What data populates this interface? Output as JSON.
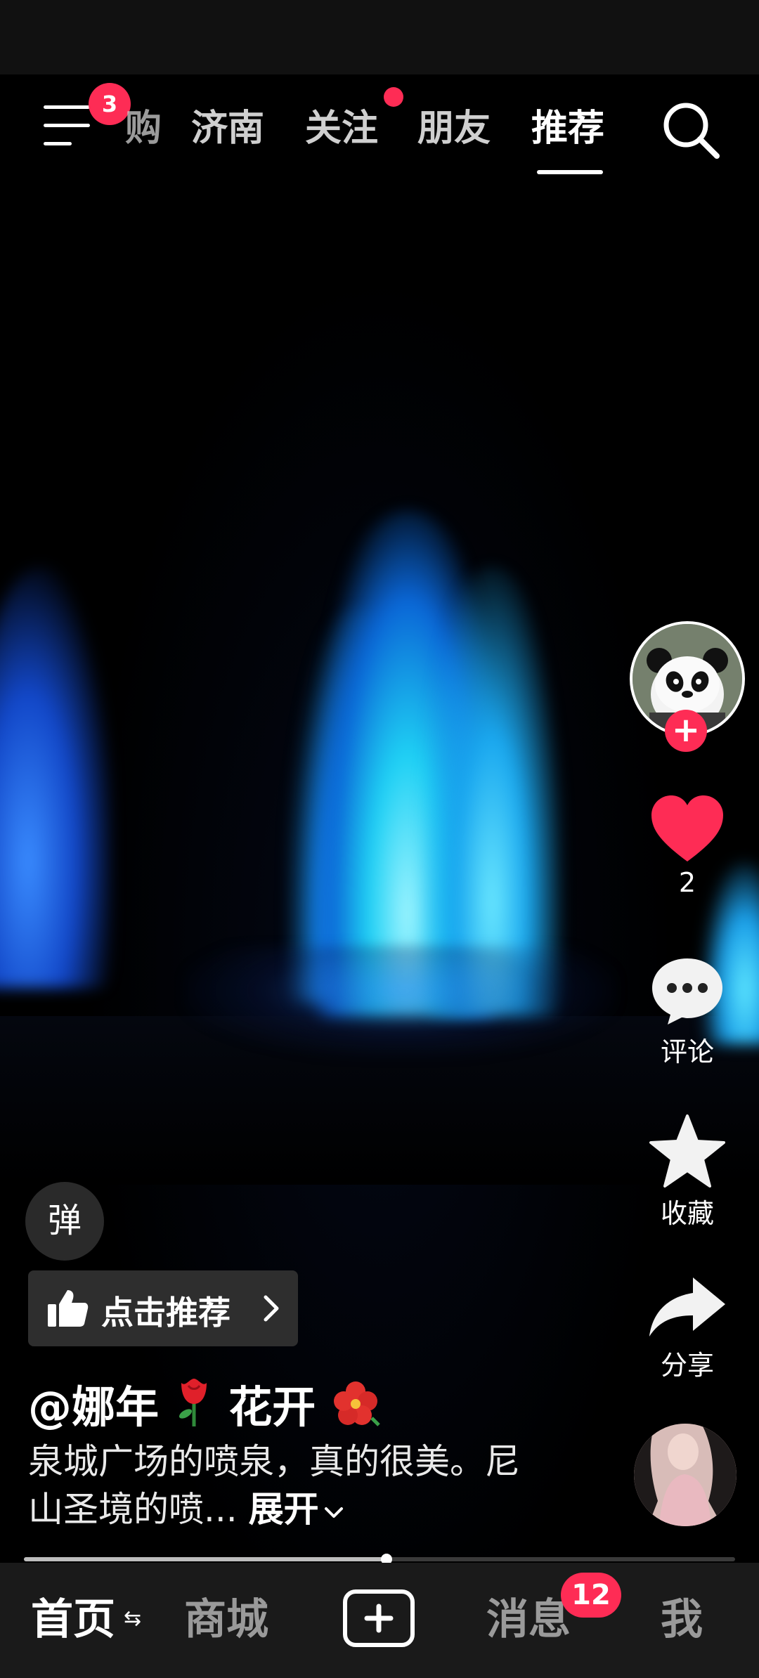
{
  "top_nav": {
    "menu_badge": "3",
    "tabs": [
      "购",
      "济南",
      "关注",
      "朋友",
      "推荐"
    ],
    "active_tab": "推荐"
  },
  "right_rail": {
    "like_count": "2",
    "comment_label": "评论",
    "favorite_label": "收藏",
    "share_label": "分享"
  },
  "overlay": {
    "danmu_label": "弹",
    "recommend_label": "点击推荐",
    "author_prefix": "@娜年",
    "author_suffix": "花开",
    "description": "泉城广场的喷泉，真的很美。尼山圣境的喷...",
    "expand_label": "展开"
  },
  "progress": {
    "played_fraction": 0.51
  },
  "bottom_nav": {
    "home": "首页",
    "mall": "商城",
    "messages": "消息",
    "messages_badge": "12",
    "me": "我"
  },
  "colors": {
    "accent": "#fe2c55",
    "background": "#000000",
    "nav_bg": "#1a1a1a"
  }
}
